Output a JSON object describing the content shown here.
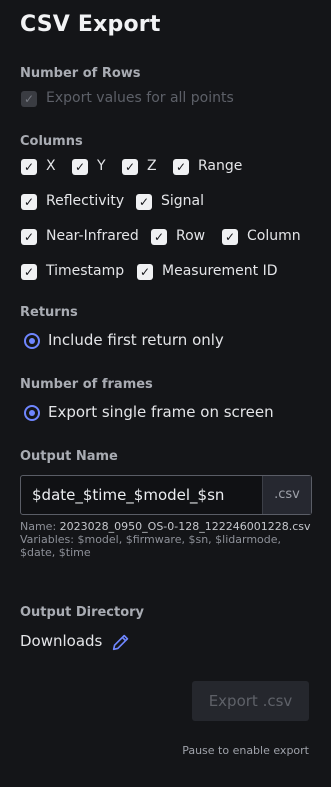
{
  "title": "CSV Export",
  "rows": {
    "label": "Number of Rows",
    "export_all": {
      "label": "Export values for all points",
      "checked": true,
      "enabled": false
    }
  },
  "columns": {
    "label": "Columns",
    "items": [
      {
        "label": "X",
        "checked": true
      },
      {
        "label": "Y",
        "checked": true
      },
      {
        "label": "Z",
        "checked": true
      },
      {
        "label": "Range",
        "checked": true
      },
      {
        "label": "Reflectivity",
        "checked": true
      },
      {
        "label": "Signal",
        "checked": true
      },
      {
        "label": "Near-Infrared",
        "checked": true
      },
      {
        "label": "Row",
        "checked": true
      },
      {
        "label": "Column",
        "checked": true
      },
      {
        "label": "Timestamp",
        "checked": true
      },
      {
        "label": "Measurement ID",
        "checked": true
      }
    ]
  },
  "returns": {
    "label": "Returns",
    "option": "Include first return only"
  },
  "frames": {
    "label": "Number of frames",
    "option": "Export single frame on screen"
  },
  "output_name": {
    "label": "Output Name",
    "value": "$date_$time_$model_$sn",
    "suffix": ".csv",
    "name_prefix": "Name:",
    "name_value": "2023028_0950_OS-0-128_122246001228.csv",
    "variables_prefix": "Variables:",
    "variables_value": "$model, $firmware, $sn, $lidarmode, $date, $time"
  },
  "output_directory": {
    "label": "Output Directory",
    "value": "Downloads"
  },
  "export_button": {
    "label": "Export .csv",
    "enabled": false
  },
  "hint": "Pause to enable export",
  "colors": {
    "accent": "#6f86ff",
    "background": "#141518"
  },
  "icons": {
    "check": "check-icon",
    "edit": "pencil-icon"
  }
}
